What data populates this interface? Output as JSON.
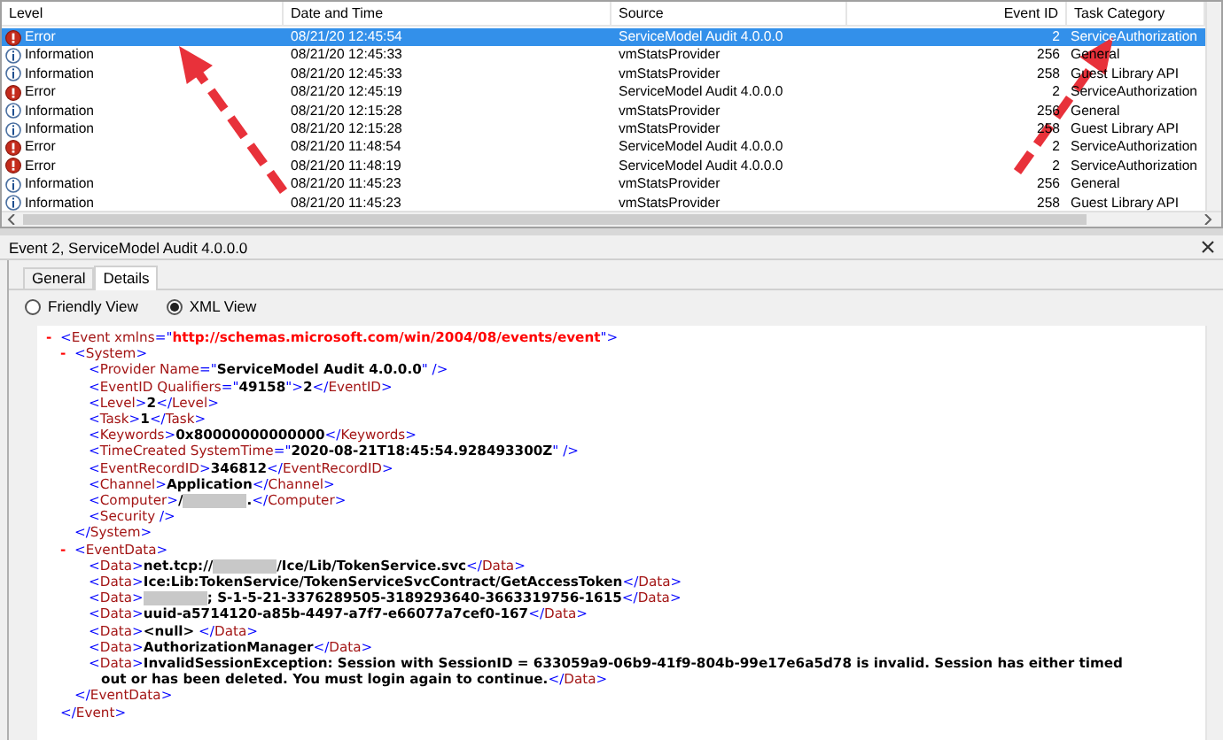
{
  "event_list": {
    "columns": [
      "Level",
      "Date and Time",
      "Source",
      "Event ID",
      "Task Category"
    ],
    "rows": [
      {
        "kind": "error",
        "level": "Error",
        "date": "08/21/20 12:45:54",
        "source": "ServiceModel Audit 4.0.0.0",
        "event_id": "2",
        "category": "ServiceAuthorization",
        "selected": true
      },
      {
        "kind": "information",
        "level": "Information",
        "date": "08/21/20 12:45:33",
        "source": "vmStatsProvider",
        "event_id": "256",
        "category": "General",
        "selected": false
      },
      {
        "kind": "information",
        "level": "Information",
        "date": "08/21/20 12:45:33",
        "source": "vmStatsProvider",
        "event_id": "258",
        "category": "Guest Library API",
        "selected": false
      },
      {
        "kind": "error",
        "level": "Error",
        "date": "08/21/20 12:45:19",
        "source": "ServiceModel Audit 4.0.0.0",
        "event_id": "2",
        "category": "ServiceAuthorization",
        "selected": false
      },
      {
        "kind": "information",
        "level": "Information",
        "date": "08/21/20 12:15:28",
        "source": "vmStatsProvider",
        "event_id": "256",
        "category": "General",
        "selected": false
      },
      {
        "kind": "information",
        "level": "Information",
        "date": "08/21/20 12:15:28",
        "source": "vmStatsProvider",
        "event_id": "258",
        "category": "Guest Library API",
        "selected": false
      },
      {
        "kind": "error",
        "level": "Error",
        "date": "08/21/20 11:48:54",
        "source": "ServiceModel Audit 4.0.0.0",
        "event_id": "2",
        "category": "ServiceAuthorization",
        "selected": false
      },
      {
        "kind": "error",
        "level": "Error",
        "date": "08/21/20 11:48:19",
        "source": "ServiceModel Audit 4.0.0.0",
        "event_id": "2",
        "category": "ServiceAuthorization",
        "selected": false
      },
      {
        "kind": "information",
        "level": "Information",
        "date": "08/21/20 11:45:23",
        "source": "vmStatsProvider",
        "event_id": "256",
        "category": "General",
        "selected": false
      },
      {
        "kind": "information",
        "level": "Information",
        "date": "08/21/20 11:45:23",
        "source": "vmStatsProvider",
        "event_id": "258",
        "category": "Guest Library API",
        "selected": false
      }
    ]
  },
  "detail": {
    "title": "Event 2, ServiceModel Audit 4.0.0.0",
    "tabs": [
      {
        "label": "General",
        "selected": false
      },
      {
        "label": "Details",
        "selected": true
      }
    ],
    "views": [
      {
        "label": "Friendly View",
        "selected": false
      },
      {
        "label": "XML View",
        "selected": true
      }
    ],
    "xml": {
      "toggle": "-",
      "open": [
        {
          "kind": "punct",
          "text": "<"
        },
        {
          "kind": "name",
          "text": "Event xmlns"
        },
        {
          "kind": "punct",
          "text": "=\""
        },
        {
          "kind": "url",
          "text": "http://schemas.microsoft.com/win/2004/08/events/event"
        },
        {
          "kind": "punct",
          "text": "\">"
        }
      ],
      "children": [
        {
          "toggle": "-",
          "open": [
            {
              "kind": "punct",
              "text": "<"
            },
            {
              "kind": "name",
              "text": "System"
            },
            {
              "kind": "punct",
              "text": ">"
            }
          ],
          "children": [
            {
              "line": [
                {
                  "kind": "punct",
                  "text": "<"
                },
                {
                  "kind": "name",
                  "text": "Provider Name"
                },
                {
                  "kind": "punct",
                  "text": "=\""
                },
                {
                  "kind": "value",
                  "text": "ServiceModel Audit 4.0.0.0"
                },
                {
                  "kind": "punct",
                  "text": "\" />"
                }
              ]
            },
            {
              "line": [
                {
                  "kind": "punct",
                  "text": "<"
                },
                {
                  "kind": "name",
                  "text": "EventID Qualifiers"
                },
                {
                  "kind": "punct",
                  "text": "=\""
                },
                {
                  "kind": "value",
                  "text": "49158"
                },
                {
                  "kind": "punct",
                  "text": "\">"
                },
                {
                  "kind": "value",
                  "text": "2"
                },
                {
                  "kind": "punct",
                  "text": "</"
                },
                {
                  "kind": "name",
                  "text": "EventID"
                },
                {
                  "kind": "punct",
                  "text": ">"
                }
              ]
            },
            {
              "line": [
                {
                  "kind": "punct",
                  "text": "<"
                },
                {
                  "kind": "name",
                  "text": "Level"
                },
                {
                  "kind": "punct",
                  "text": ">"
                },
                {
                  "kind": "value",
                  "text": "2"
                },
                {
                  "kind": "punct",
                  "text": "</"
                },
                {
                  "kind": "name",
                  "text": "Level"
                },
                {
                  "kind": "punct",
                  "text": ">"
                }
              ]
            },
            {
              "line": [
                {
                  "kind": "punct",
                  "text": "<"
                },
                {
                  "kind": "name",
                  "text": "Task"
                },
                {
                  "kind": "punct",
                  "text": ">"
                },
                {
                  "kind": "value",
                  "text": "1"
                },
                {
                  "kind": "punct",
                  "text": "</"
                },
                {
                  "kind": "name",
                  "text": "Task"
                },
                {
                  "kind": "punct",
                  "text": ">"
                }
              ]
            },
            {
              "line": [
                {
                  "kind": "punct",
                  "text": "<"
                },
                {
                  "kind": "name",
                  "text": "Keywords"
                },
                {
                  "kind": "punct",
                  "text": ">"
                },
                {
                  "kind": "value",
                  "text": "0x80000000000000"
                },
                {
                  "kind": "punct",
                  "text": "</"
                },
                {
                  "kind": "name",
                  "text": "Keywords"
                },
                {
                  "kind": "punct",
                  "text": ">"
                }
              ]
            },
            {
              "line": [
                {
                  "kind": "punct",
                  "text": "<"
                },
                {
                  "kind": "name",
                  "text": "TimeCreated SystemTime"
                },
                {
                  "kind": "punct",
                  "text": "=\""
                },
                {
                  "kind": "value",
                  "text": "2020-08-21T18:45:54.928493300Z"
                },
                {
                  "kind": "punct",
                  "text": "\" />"
                }
              ]
            },
            {
              "line": [
                {
                  "kind": "punct",
                  "text": "<"
                },
                {
                  "kind": "name",
                  "text": "EventRecordID"
                },
                {
                  "kind": "punct",
                  "text": ">"
                },
                {
                  "kind": "value",
                  "text": "346812"
                },
                {
                  "kind": "punct",
                  "text": "</"
                },
                {
                  "kind": "name",
                  "text": "EventRecordID"
                },
                {
                  "kind": "punct",
                  "text": ">"
                }
              ]
            },
            {
              "line": [
                {
                  "kind": "punct",
                  "text": "<"
                },
                {
                  "kind": "name",
                  "text": "Channel"
                },
                {
                  "kind": "punct",
                  "text": ">"
                },
                {
                  "kind": "value",
                  "text": "Application"
                },
                {
                  "kind": "punct",
                  "text": "</"
                },
                {
                  "kind": "name",
                  "text": "Channel"
                },
                {
                  "kind": "punct",
                  "text": ">"
                }
              ]
            },
            {
              "line": [
                {
                  "kind": "punct",
                  "text": "<"
                },
                {
                  "kind": "name",
                  "text": "Computer"
                },
                {
                  "kind": "punct",
                  "text": ">"
                },
                {
                  "kind": "value",
                  "text": "/"
                },
                {
                  "kind": "redacted"
                },
                {
                  "kind": "value",
                  "text": "."
                },
                {
                  "kind": "punct",
                  "text": "</"
                },
                {
                  "kind": "name",
                  "text": "Computer"
                },
                {
                  "kind": "punct",
                  "text": ">"
                }
              ]
            },
            {
              "line": [
                {
                  "kind": "punct",
                  "text": "<"
                },
                {
                  "kind": "name",
                  "text": "Security"
                },
                {
                  "kind": "punct",
                  "text": " />"
                }
              ]
            }
          ],
          "close": [
            {
              "kind": "punct",
              "text": "</"
            },
            {
              "kind": "name",
              "text": "System"
            },
            {
              "kind": "punct",
              "text": ">"
            }
          ]
        },
        {
          "toggle": "-",
          "open": [
            {
              "kind": "punct",
              "text": "<"
            },
            {
              "kind": "name",
              "text": "EventData"
            },
            {
              "kind": "punct",
              "text": ">"
            }
          ],
          "children": [
            {
              "line": [
                {
                  "kind": "punct",
                  "text": "<"
                },
                {
                  "kind": "name",
                  "text": "Data"
                },
                {
                  "kind": "punct",
                  "text": ">"
                },
                {
                  "kind": "value",
                  "text": "net.tcp://"
                },
                {
                  "kind": "redacted"
                },
                {
                  "kind": "value",
                  "text": "/Ice/Lib/TokenService.svc"
                },
                {
                  "kind": "punct",
                  "text": "</"
                },
                {
                  "kind": "name",
                  "text": "Data"
                },
                {
                  "kind": "punct",
                  "text": ">"
                }
              ]
            },
            {
              "line": [
                {
                  "kind": "punct",
                  "text": "<"
                },
                {
                  "kind": "name",
                  "text": "Data"
                },
                {
                  "kind": "punct",
                  "text": ">"
                },
                {
                  "kind": "value",
                  "text": "Ice:Lib:TokenService/TokenServiceSvcContract/GetAccessToken"
                },
                {
                  "kind": "punct",
                  "text": "</"
                },
                {
                  "kind": "name",
                  "text": "Data"
                },
                {
                  "kind": "punct",
                  "text": ">"
                }
              ]
            },
            {
              "line": [
                {
                  "kind": "punct",
                  "text": "<"
                },
                {
                  "kind": "name",
                  "text": "Data"
                },
                {
                  "kind": "punct",
                  "text": ">"
                },
                {
                  "kind": "redacted"
                },
                {
                  "kind": "value",
                  "text": "; S-1-5-21-3376289505-3189293640-3663319756-1615"
                },
                {
                  "kind": "punct",
                  "text": "</"
                },
                {
                  "kind": "name",
                  "text": "Data"
                },
                {
                  "kind": "punct",
                  "text": ">"
                }
              ]
            },
            {
              "line": [
                {
                  "kind": "punct",
                  "text": "<"
                },
                {
                  "kind": "name",
                  "text": "Data"
                },
                {
                  "kind": "punct",
                  "text": ">"
                },
                {
                  "kind": "value",
                  "text": "uuid-a5714120-a85b-4497-a7f7-e66077a7cef0-167"
                },
                {
                  "kind": "punct",
                  "text": "</"
                },
                {
                  "kind": "name",
                  "text": "Data"
                },
                {
                  "kind": "punct",
                  "text": ">"
                }
              ]
            },
            {
              "line": [
                {
                  "kind": "punct",
                  "text": "<"
                },
                {
                  "kind": "name",
                  "text": "Data"
                },
                {
                  "kind": "punct",
                  "text": ">"
                },
                {
                  "kind": "value",
                  "text": "<null>"
                },
                {
                  "kind": "punct",
                  "text": " </"
                },
                {
                  "kind": "name",
                  "text": "Data"
                },
                {
                  "kind": "punct",
                  "text": ">"
                }
              ]
            },
            {
              "line": [
                {
                  "kind": "punct",
                  "text": "<"
                },
                {
                  "kind": "name",
                  "text": "Data"
                },
                {
                  "kind": "punct",
                  "text": ">"
                },
                {
                  "kind": "value",
                  "text": "AuthorizationManager"
                },
                {
                  "kind": "punct",
                  "text": "</"
                },
                {
                  "kind": "name",
                  "text": "Data"
                },
                {
                  "kind": "punct",
                  "text": ">"
                }
              ]
            },
            {
              "line": [
                {
                  "kind": "punct",
                  "text": "<"
                },
                {
                  "kind": "name",
                  "text": "Data"
                },
                {
                  "kind": "punct",
                  "text": ">"
                },
                {
                  "kind": "value",
                  "text": "InvalidSessionException: Session with SessionID = 633059a9-06b9-41f9-804b-99e17e6a5d78 is invalid. Session has either timed out or has been deleted. You must login again to continue."
                },
                {
                  "kind": "punct",
                  "text": "</"
                },
                {
                  "kind": "name",
                  "text": "Data"
                },
                {
                  "kind": "punct",
                  "text": ">"
                }
              ]
            }
          ],
          "close": [
            {
              "kind": "punct",
              "text": "</"
            },
            {
              "kind": "name",
              "text": "EventData"
            },
            {
              "kind": "punct",
              "text": ">"
            }
          ]
        }
      ],
      "close": [
        {
          "kind": "punct",
          "text": "</"
        },
        {
          "kind": "name",
          "text": "Event"
        },
        {
          "kind": "punct",
          "text": ">"
        }
      ]
    }
  }
}
